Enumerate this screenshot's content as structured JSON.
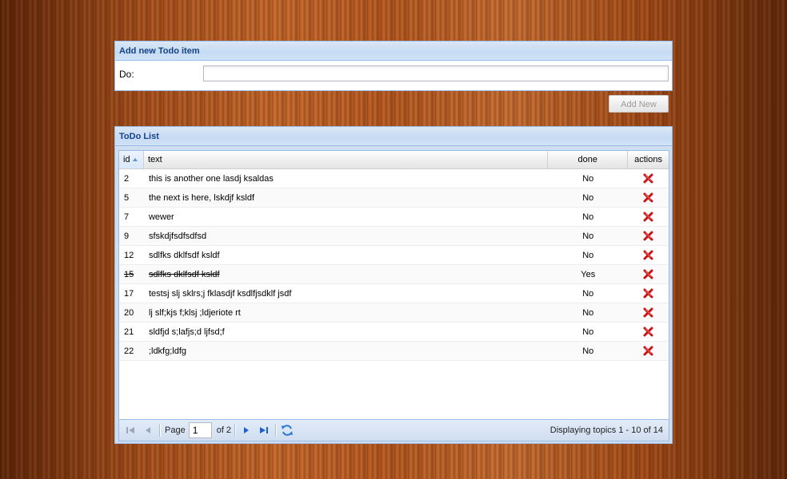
{
  "add_panel": {
    "title": "Add new Todo item",
    "field_label": "Do:",
    "field_value": "",
    "button_label": "Add New"
  },
  "list_panel": {
    "title": "ToDo List",
    "columns": [
      "id",
      "text",
      "done",
      "actions"
    ],
    "sort": {
      "column": "id",
      "direction": "asc"
    },
    "rows": [
      {
        "id": "2",
        "text": "this is another one lasdj ksaldas",
        "done": "No"
      },
      {
        "id": "5",
        "text": "the next is here, lskdjf ksldf",
        "done": "No"
      },
      {
        "id": "7",
        "text": "wewer",
        "done": "No"
      },
      {
        "id": "9",
        "text": "sfskdjfsdfsdfsd",
        "done": "No"
      },
      {
        "id": "12",
        "text": "sdlfks dklfsdf ksldf",
        "done": "No"
      },
      {
        "id": "15",
        "text": "sdlfks dklfsdf ksldf",
        "done": "Yes"
      },
      {
        "id": "17",
        "text": "testsj slj sklrs;j fklasdjf ksdlfjsdklf jsdf",
        "done": "No"
      },
      {
        "id": "20",
        "text": "lj slf;kjs f;klsj ;ldjeriote rt",
        "done": "No"
      },
      {
        "id": "21",
        "text": "sldfjd s;lafjs;d ljfsd;f",
        "done": "No"
      },
      {
        "id": "22",
        "text": ";ldkfg;ldfg",
        "done": "No"
      }
    ],
    "action_icon": "delete-icon",
    "paging": {
      "page_label": "Page",
      "page_value": "1",
      "of_label": "of 2",
      "status": "Displaying topics 1 - 10 of 14"
    }
  },
  "colors": {
    "header_text": "#15428b",
    "border": "#99bbe8",
    "delete": "#cc1111"
  }
}
